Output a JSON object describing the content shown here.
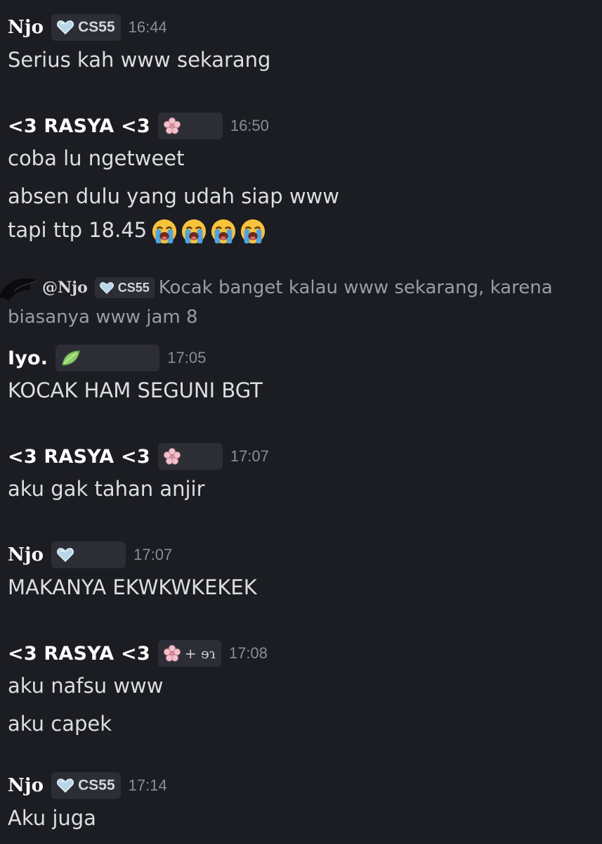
{
  "messages": [
    {
      "user": "Njo",
      "tag": "CS55",
      "time": "16:44",
      "lines": [
        "Serius kah www sekarang"
      ]
    },
    {
      "user": "<3 RASYA <3",
      "tag": "",
      "time": "16:50",
      "lines": [
        "coba lu ngetweet",
        "absen dulu yang udah siap www",
        "tapi ttp 18.45"
      ],
      "emoji_count": 4
    },
    {
      "reply": {
        "user": "@Njo",
        "tag": "CS55",
        "text_line1": "Kocak banget kalau www sekarang, karena",
        "text_line2": "biasanya www jam 8"
      },
      "user": "Iyo.",
      "tag": "",
      "time": "17:05",
      "lines": [
        "KOCAK HAM SEGUNI BGT"
      ]
    },
    {
      "user": "<3 RASYA <3",
      "tag": "",
      "time": "17:07",
      "lines": [
        "aku gak tahan anjir"
      ]
    },
    {
      "user": "Njo",
      "tag": "",
      "time": "17:07",
      "lines": [
        "MAKANYA EKWKWKEKEK"
      ]
    },
    {
      "user": "<3 RASYA <3",
      "tag": "+ ɘɿ",
      "time": "17:08",
      "lines": [
        "aku nafsu www",
        "aku capek"
      ]
    },
    {
      "user": "Njo",
      "tag": "CS55",
      "time": "17:14",
      "lines": [
        "Aku juga"
      ]
    }
  ],
  "icons": {
    "heart_tag": "heart-icon",
    "flower_tag": "flower-icon",
    "leaf_tag": "leaf-icon",
    "cry_emoji": "loudly-crying-face-icon"
  },
  "colors": {
    "background": "#1c1d22",
    "username": "#ffffff",
    "message": "#dcdee3",
    "timestamp": "#8b8d96",
    "tag_bg": "#2d2e35",
    "reply_text": "#9a9ca4"
  }
}
